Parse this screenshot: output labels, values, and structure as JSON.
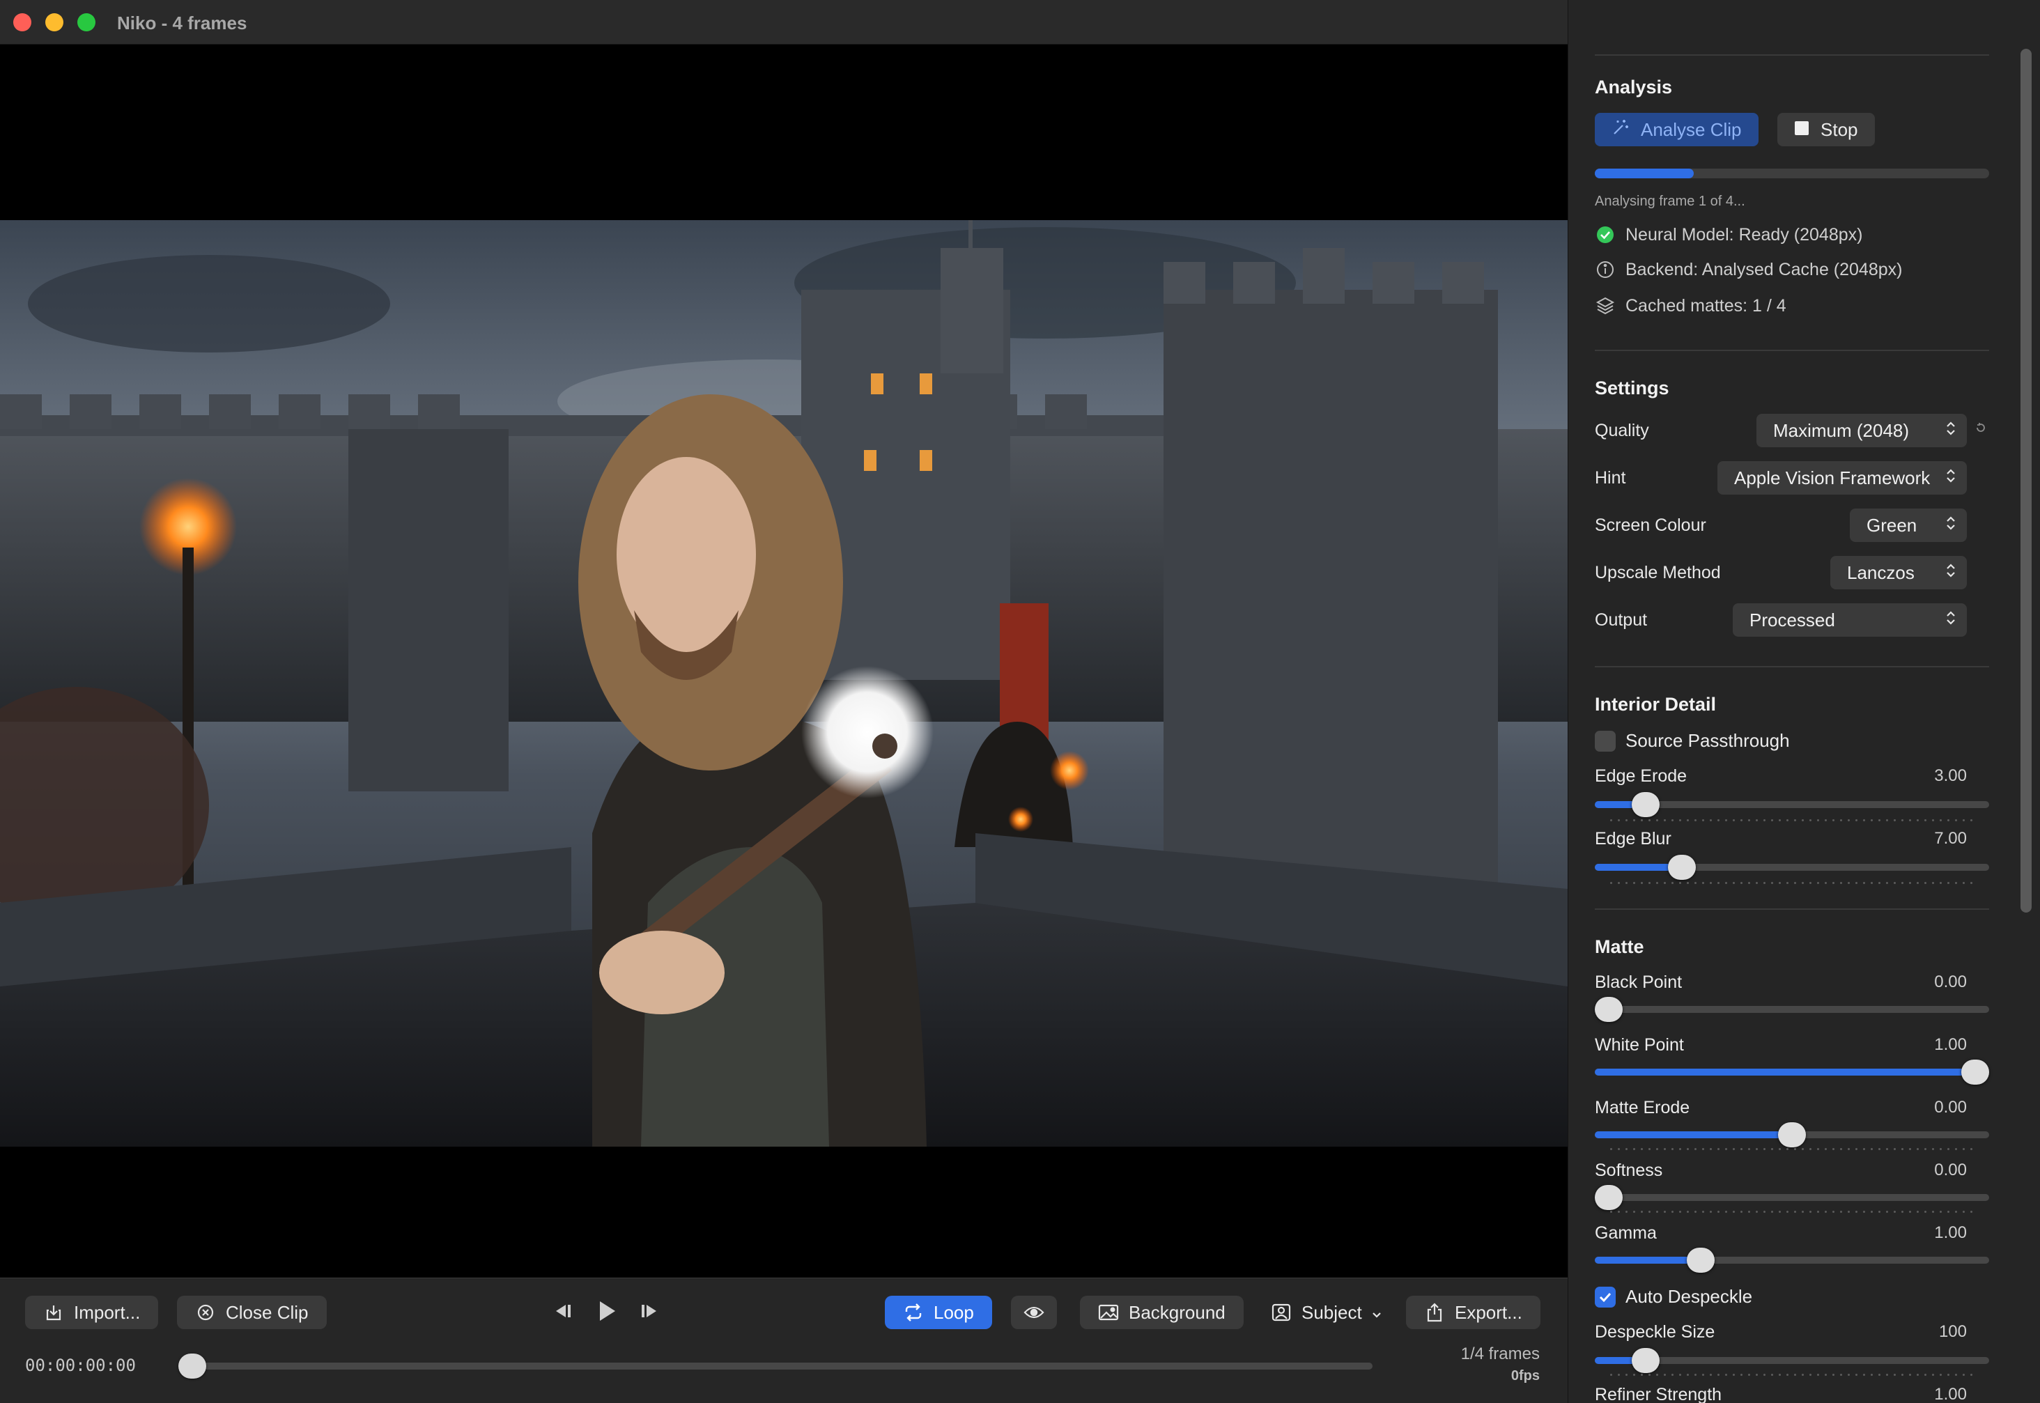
{
  "window": {
    "title": "Niko - 4 frames"
  },
  "toolbar": {
    "import_label": "Import...",
    "close_clip_label": "Close Clip",
    "loop_label": "Loop",
    "background_label": "Background",
    "subject_label": "Subject",
    "export_label": "Export..."
  },
  "timeline": {
    "timecode": "00:00:00:00",
    "frame_counter": "1/4 frames",
    "fps": "0fps",
    "playhead_fraction": 0.0
  },
  "analysis": {
    "title": "Analysis",
    "analyse_label": "Analyse Clip",
    "stop_label": "Stop",
    "progress_fraction": 0.25,
    "progress_text": "Analysing frame 1 of 4...",
    "neural_model": "Neural Model: Ready (2048px)",
    "backend": "Backend: Analysed Cache (2048px)",
    "cached_mattes": "Cached mattes: 1 / 4"
  },
  "settings": {
    "title": "Settings",
    "quality_label": "Quality",
    "quality_value": "Maximum (2048)",
    "hint_label": "Hint",
    "hint_value": "Apple Vision Framework",
    "screen_colour_label": "Screen Colour",
    "screen_colour_value": "Green",
    "upscale_label": "Upscale Method",
    "upscale_value": "Lanczos",
    "output_label": "Output",
    "output_value": "Processed"
  },
  "interior_detail": {
    "title": "Interior Detail",
    "source_passthrough_label": "Source Passthrough",
    "source_passthrough_checked": false,
    "edge_erode_label": "Edge Erode",
    "edge_erode_value": "3.00",
    "edge_erode_fraction": 0.1,
    "edge_blur_label": "Edge Blur",
    "edge_blur_value": "7.00",
    "edge_blur_fraction": 0.2
  },
  "matte": {
    "title": "Matte",
    "black_point_label": "Black Point",
    "black_point_value": "0.00",
    "black_point_fraction": 0.0,
    "white_point_label": "White Point",
    "white_point_value": "1.00",
    "white_point_fraction": 1.0,
    "matte_erode_label": "Matte Erode",
    "matte_erode_value": "0.00",
    "matte_erode_fraction": 0.5,
    "softness_label": "Softness",
    "softness_value": "0.00",
    "softness_fraction": 0.0,
    "gamma_label": "Gamma",
    "gamma_value": "1.00",
    "gamma_fraction": 0.25,
    "auto_despeckle_label": "Auto Despeckle",
    "auto_despeckle_checked": true,
    "despeckle_size_label": "Despeckle Size",
    "despeckle_size_value": "100",
    "despeckle_size_fraction": 0.1,
    "refiner_strength_label": "Refiner Strength",
    "refiner_strength_value": "1.00"
  },
  "colors": {
    "accent": "#2f6ee5",
    "panel_bg": "#252525",
    "button_bg": "#3a3a3a",
    "success": "#34c759"
  },
  "icons": {
    "close": "traffic-close",
    "minimize": "traffic-minimize",
    "maximize": "traffic-maximize",
    "import": "import-icon",
    "close_clip": "circle-x-icon",
    "step_back": "step-backward-icon",
    "play": "play-icon",
    "step_forward": "step-forward-icon",
    "loop": "loop-icon",
    "preview": "eye-icon",
    "background": "image-icon",
    "subject": "person-icon",
    "export": "share-icon",
    "analyse": "magic-wand-icon",
    "stop": "stop-icon",
    "ready": "check-circle-icon",
    "info": "info-icon",
    "layers": "layers-icon"
  }
}
